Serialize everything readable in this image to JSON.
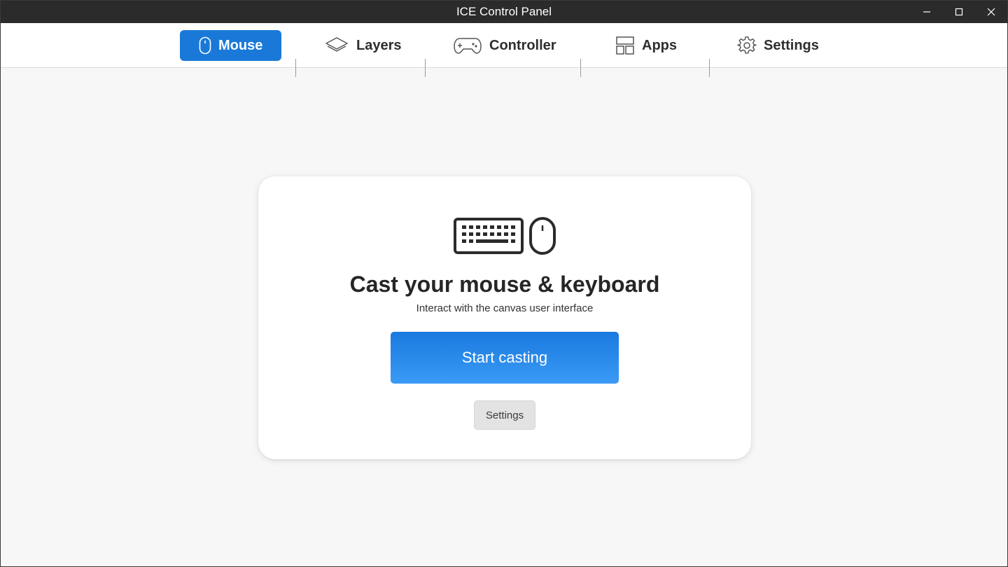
{
  "window": {
    "title": "ICE Control Panel"
  },
  "tabs": [
    {
      "label": "Mouse",
      "icon": "mouse-icon",
      "active": true
    },
    {
      "label": "Layers",
      "icon": "layers-icon",
      "active": false
    },
    {
      "label": "Controller",
      "icon": "gamepad-icon",
      "active": false
    },
    {
      "label": "Apps",
      "icon": "apps-grid-icon",
      "active": false
    },
    {
      "label": "Settings",
      "icon": "gear-icon",
      "active": false
    }
  ],
  "card": {
    "icons": [
      "keyboard-icon",
      "mouse-icon"
    ],
    "heading": "Cast your mouse & keyboard",
    "subtitle": "Interact with the canvas user interface",
    "start_button": "Start casting",
    "settings_button": "Settings"
  },
  "colors": {
    "accent": "#1a79d8",
    "titlebar": "#2b2b2b",
    "background": "#f7f7f7"
  }
}
